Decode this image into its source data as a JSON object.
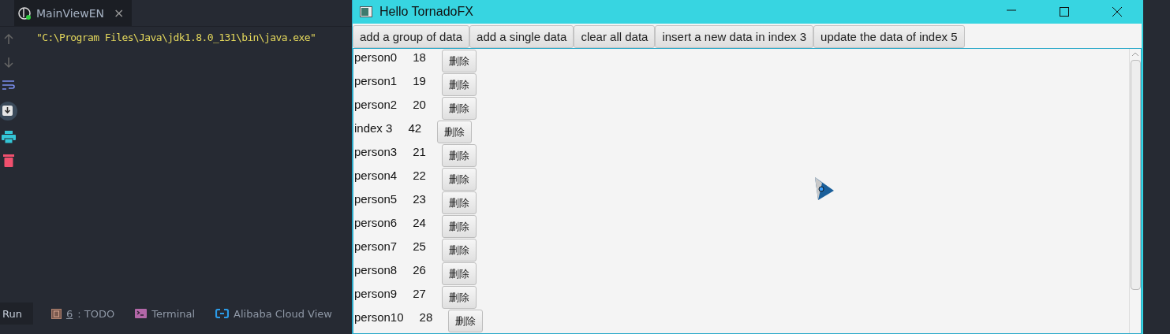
{
  "ide": {
    "tab": {
      "title": "MainViewEN",
      "close": "×",
      "selected": true
    },
    "console_lines": [
      "\"C:\\Program Files\\Java\\jdk1.8.0_131\\bin\\java.exe\""
    ],
    "tool_windows": [
      {
        "kind": "run",
        "label": "Run",
        "selected": true
      },
      {
        "kind": "todo",
        "mnemonic": "6",
        "label": ": TODO",
        "selected": false
      },
      {
        "kind": "terminal",
        "label": "Terminal",
        "selected": false
      },
      {
        "kind": "cloud",
        "label": "Alibaba Cloud View",
        "selected": false
      }
    ]
  },
  "window": {
    "title": "Hello TornadoFX",
    "toolbar": [
      "add a group of data",
      "add a single data",
      "clear all data",
      "insert a new data in index 3",
      "update the data of index 5"
    ],
    "rows": [
      {
        "name": "person0",
        "age": "18",
        "button": "删除"
      },
      {
        "name": "person1",
        "age": "19",
        "button": "删除"
      },
      {
        "name": "person2",
        "age": "20",
        "button": "删除"
      },
      {
        "name": "index 3",
        "age": "42",
        "button": "删除"
      },
      {
        "name": "person3",
        "age": "21",
        "button": "删除"
      },
      {
        "name": "person4",
        "age": "22",
        "button": "删除"
      },
      {
        "name": "person5",
        "age": "23",
        "button": "删除"
      },
      {
        "name": "person6",
        "age": "24",
        "button": "删除"
      },
      {
        "name": "person7",
        "age": "25",
        "button": "删除"
      },
      {
        "name": "person8",
        "age": "26",
        "button": "删除"
      },
      {
        "name": "person9",
        "age": "27",
        "button": "删除"
      },
      {
        "name": "person10",
        "age": "28",
        "button": "删除"
      }
    ]
  }
}
